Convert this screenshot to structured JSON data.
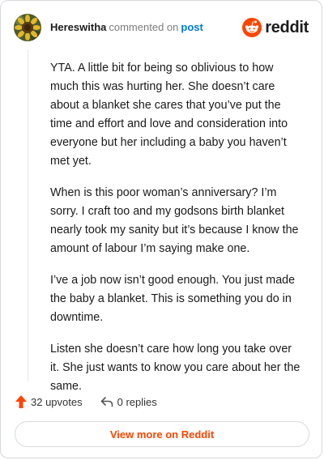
{
  "comment": {
    "author": "Hereswitha",
    "action_text": "commented on",
    "post_link": "post",
    "paragraphs": [
      "YTA. A little bit for being so oblivious to how much this was hurting her. She doesn’t care about a blanket she cares that you’ve put the time and effort and love and consideration into everyone but her including a baby you haven’t met yet.",
      "When is this poor woman’s anniversary? I’m sorry. I craft too and my godsons birth blanket nearly took my sanity but it’s because I know the amount of labour I’m saying make one.",
      "I’ve a job now isn’t good enough. You just made the baby a blanket. This is something you do in downtime.",
      "Listen she doesn’t care how long you take over it. She just wants to know you care about her the same."
    ]
  },
  "brand": {
    "wordmark": "reddit",
    "color": "#ff4500"
  },
  "stats": {
    "upvotes": "32 upvotes",
    "replies": "0 replies"
  },
  "cta": {
    "label": "View more on Reddit"
  },
  "icons": {
    "avatar": "sunflower-avatar",
    "logo": "reddit-snoo-icon",
    "upvote": "upvote-arrow-icon",
    "reply": "reply-arrow-icon"
  }
}
